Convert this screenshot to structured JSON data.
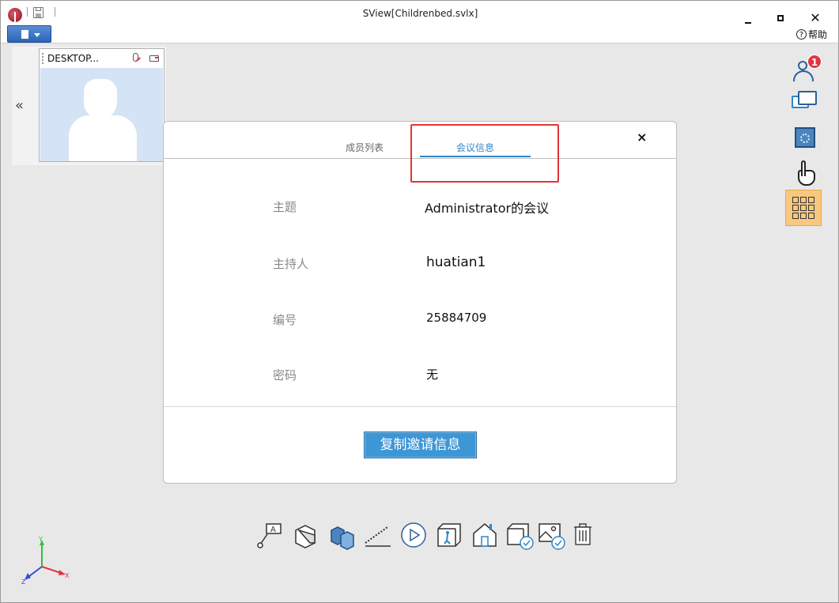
{
  "window": {
    "title": "SView[Childrenbed.svlx]",
    "help_label": "帮助",
    "help_symbol": "?",
    "close_symbol": "✕"
  },
  "participant": {
    "name": "DESKTOP..."
  },
  "sidebar": {
    "users_badge": "1",
    "icons": [
      "users-icon",
      "chat-icon",
      "model-settings-icon",
      "hand-icon",
      "grid-icon"
    ],
    "active_color": "#f9c780"
  },
  "dialog": {
    "tabs": [
      {
        "label": "成员列表",
        "active": false
      },
      {
        "label": "会议信息",
        "active": true
      }
    ],
    "close_symbol": "×",
    "rows": [
      {
        "label": "主题",
        "value": "Administrator的会议"
      },
      {
        "label": "主持人",
        "value": "huatian1"
      },
      {
        "label": "编号",
        "value": "25884709"
      },
      {
        "label": "密码",
        "value": "无"
      }
    ],
    "copy_button": "复制邀请信息",
    "accent_color": "#2f86c9"
  },
  "toolbar": {
    "tools": [
      "annotation-icon",
      "section-view-icon",
      "explode-icon",
      "measure-icon",
      "play-icon",
      "walkthrough-icon",
      "home-view-icon",
      "view-check-icon",
      "image-check-icon",
      "delete-icon"
    ]
  },
  "axis": {
    "x_label": "X",
    "y_label": "Y",
    "z_label": "Z"
  },
  "collapse_symbol": "«"
}
